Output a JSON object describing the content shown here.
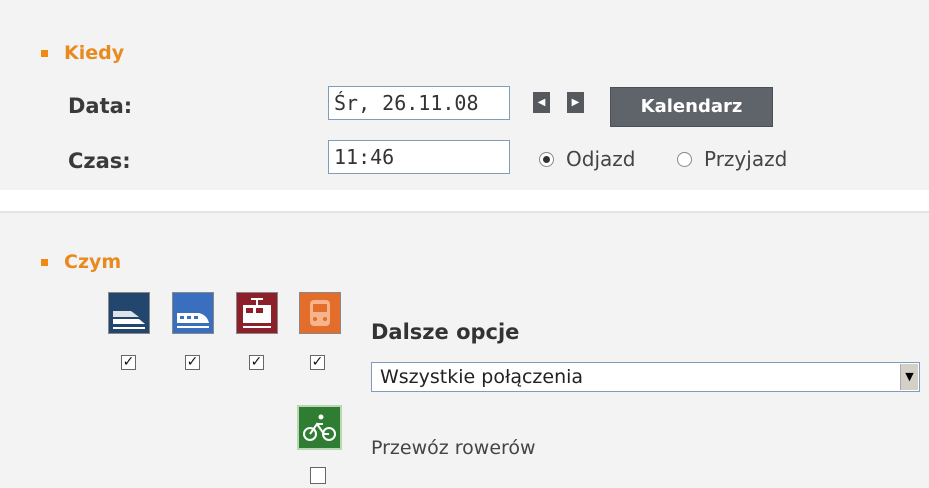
{
  "when": {
    "heading": "Kiedy",
    "date_label": "Data:",
    "date_value": "Śr, 26.11.08",
    "calendar_button": "Kalendarz",
    "time_label": "Czas:",
    "time_value": "11:46",
    "radio_departure": "Odjazd",
    "radio_arrival": "Przyjazd",
    "selected_radio": "Odjazd"
  },
  "by": {
    "heading": "Czym",
    "modes": [
      {
        "icon": "express-train-icon",
        "checked": true,
        "color": "#23466f"
      },
      {
        "icon": "intercity-train-icon",
        "checked": true,
        "color": "#3a6fc0"
      },
      {
        "icon": "regional-train-icon",
        "checked": true,
        "color": "#8c1f2a"
      },
      {
        "icon": "tram-icon",
        "checked": true,
        "color": "#e36d2a"
      }
    ],
    "more_options_title": "Dalsze opcje",
    "connections_select": "Wszystkie połączenia",
    "bike_icon_color": "#2e7d32",
    "bike_label": "Przewóz rowerów",
    "bike_checked": false
  },
  "colors": {
    "accent": "#e98a1f",
    "panel_bg": "#f3f3f3",
    "button_bg": "#5f646a"
  }
}
